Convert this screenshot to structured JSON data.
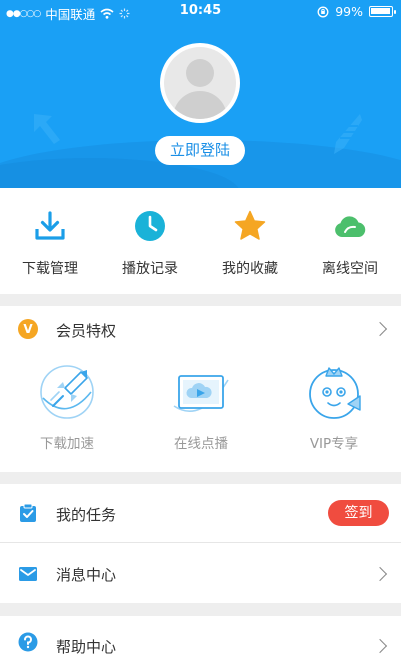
{
  "status_bar": {
    "signal_dots": "●●○○○",
    "carrier": "中国联通",
    "time": "10:45",
    "battery_percent": "99%",
    "battery_level": 0.99
  },
  "profile": {
    "login_label": "立即登陆"
  },
  "quick_actions": [
    {
      "label": "下载管理",
      "icon": "download-icon",
      "color": "#1a9ee8"
    },
    {
      "label": "播放记录",
      "icon": "clock-icon",
      "color": "#1ab2d8"
    },
    {
      "label": "我的收藏",
      "icon": "star-icon",
      "color": "#f5a623"
    },
    {
      "label": "离线空间",
      "icon": "cloud-icon",
      "color": "#4cbf6c"
    }
  ],
  "vip": {
    "badge": "V",
    "title": "会员特权",
    "items": [
      {
        "label": "下载加速",
        "icon": "rocket-icon"
      },
      {
        "label": "在线点播",
        "icon": "video-screen-icon"
      },
      {
        "label": "VIP专享",
        "icon": "mascot-icon"
      }
    ]
  },
  "list": {
    "tasks": {
      "label": "我的任务",
      "icon": "clipboard-check-icon",
      "action": "签到"
    },
    "messages": {
      "label": "消息中心",
      "icon": "envelope-icon"
    },
    "help": {
      "label": "帮助中心",
      "icon": "question-icon"
    }
  },
  "colors": {
    "header_blue": "#1aa0f5",
    "accent_blue": "#1a8fe6",
    "sign_red": "#f04c3f",
    "vip_orange": "#f5a623"
  }
}
